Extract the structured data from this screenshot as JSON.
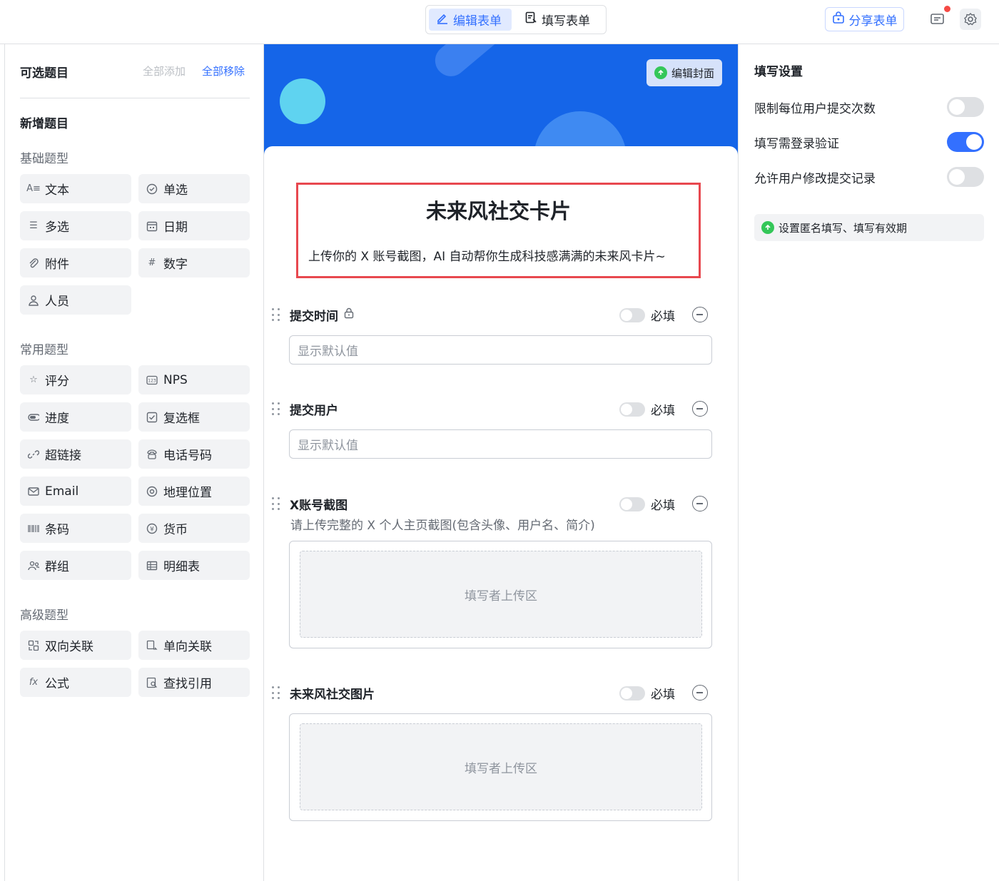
{
  "topbar": {
    "edit_form": "编辑表单",
    "fill_form": "填写表单",
    "share_form": "分享表单"
  },
  "left": {
    "title": "可选题目",
    "add_all": "全部添加",
    "remove_all": "全部移除",
    "new_section": "新增题目",
    "groups": {
      "basic": "基础题型",
      "common": "常用题型",
      "advanced": "高级题型"
    },
    "basic_items": [
      "文本",
      "单选",
      "多选",
      "日期",
      "附件",
      "数字",
      "人员"
    ],
    "common_items": [
      "评分",
      "NPS",
      "进度",
      "复选框",
      "超链接",
      "电话号码",
      "Email",
      "地理位置",
      "条码",
      "货币",
      "群组",
      "明细表"
    ],
    "advanced_items": [
      "双向关联",
      "单向关联",
      "公式",
      "查找引用"
    ]
  },
  "center": {
    "edit_cover": "编辑封面",
    "form_title": "未来风社交卡片",
    "form_desc": "上传你的 X 账号截图，AI 自动帮你生成科技感满满的未来风卡片~",
    "required_label": "必填",
    "fields": [
      {
        "label": "提交时间",
        "placeholder": "显示默认值"
      },
      {
        "label": "提交用户",
        "placeholder": "显示默认值"
      },
      {
        "label": "X账号截图",
        "hint": "请上传完整的 X 个人主页截图(包含头像、用户名、简介)",
        "upload": "填写者上传区"
      },
      {
        "label": "未来风社交图片",
        "upload": "填写者上传区"
      }
    ]
  },
  "right": {
    "title": "填写设置",
    "settings": [
      {
        "label": "限制每位用户提交次数",
        "on": false
      },
      {
        "label": "填写需登录验证",
        "on": true
      },
      {
        "label": "允许用户修改提交记录",
        "on": false
      }
    ],
    "extra": "设置匿名填写、填写有效期"
  },
  "colors": {
    "accent": "#3370ff",
    "cover": "#1565e8",
    "highlight_border": "#e8484f"
  }
}
